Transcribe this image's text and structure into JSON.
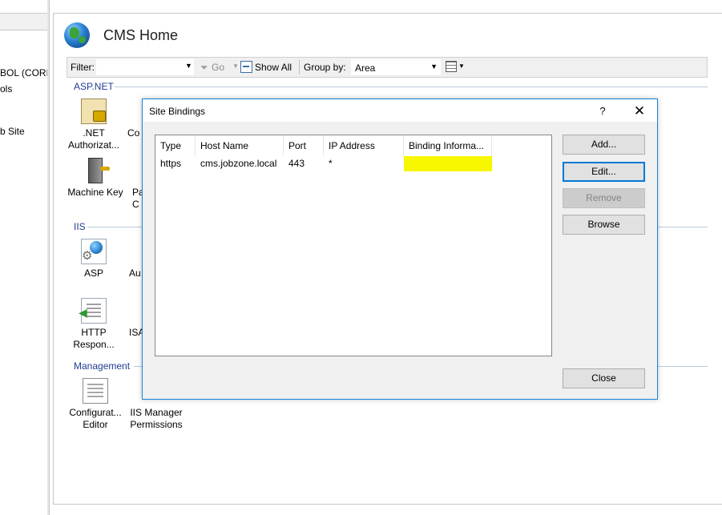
{
  "left_pane": {
    "items": [
      "BOL (CORPV",
      "ols",
      "b Site"
    ]
  },
  "header": {
    "title": "CMS Home",
    "icon": "globe-icon"
  },
  "filter_bar": {
    "filter_label": "Filter:",
    "filter_value": "",
    "go_label": "Go",
    "show_all_label": "Show All",
    "group_by_label": "Group by:",
    "group_by_value": "Area"
  },
  "groups": {
    "aspnet": {
      "title": "ASP.NET",
      "features": [
        {
          "label": ".NET\nAuthorizat...",
          "icon": "lock-icon"
        },
        {
          "label": "Co",
          "icon": "partial"
        },
        {
          "label": "Machine Key",
          "icon": "server-key-icon"
        },
        {
          "label": "Pa\nC",
          "icon": "partial"
        }
      ]
    },
    "iis": {
      "title": "IIS",
      "features": [
        {
          "label": "ASP",
          "icon": "asp-globe-gear-icon"
        },
        {
          "label": "Au",
          "icon": "partial"
        },
        {
          "label": "HTTP\nRespon...",
          "icon": "http-response-icon"
        },
        {
          "label": "ISA",
          "icon": "partial"
        }
      ]
    },
    "management": {
      "title": "Management",
      "features": [
        {
          "label": "Configurat...\nEditor",
          "icon": "config-editor-icon"
        },
        {
          "label": "IIS Manager\nPermissions",
          "icon": "partial"
        }
      ]
    }
  },
  "dialog": {
    "title": "Site Bindings",
    "help_label": "?",
    "close_label": "✕",
    "columns": [
      "Type",
      "Host Name",
      "Port",
      "IP Address",
      "Binding Informa..."
    ],
    "rows": [
      {
        "type": "https",
        "host": "cms.jobzone.local",
        "port": "443",
        "ip": "*",
        "binding_info": ""
      }
    ],
    "buttons": {
      "add": "Add...",
      "edit": "Edit...",
      "remove": "Remove",
      "browse": "Browse",
      "close": "Close"
    },
    "highlight_color": "#f7f700",
    "accent_color": "#1883d7"
  }
}
